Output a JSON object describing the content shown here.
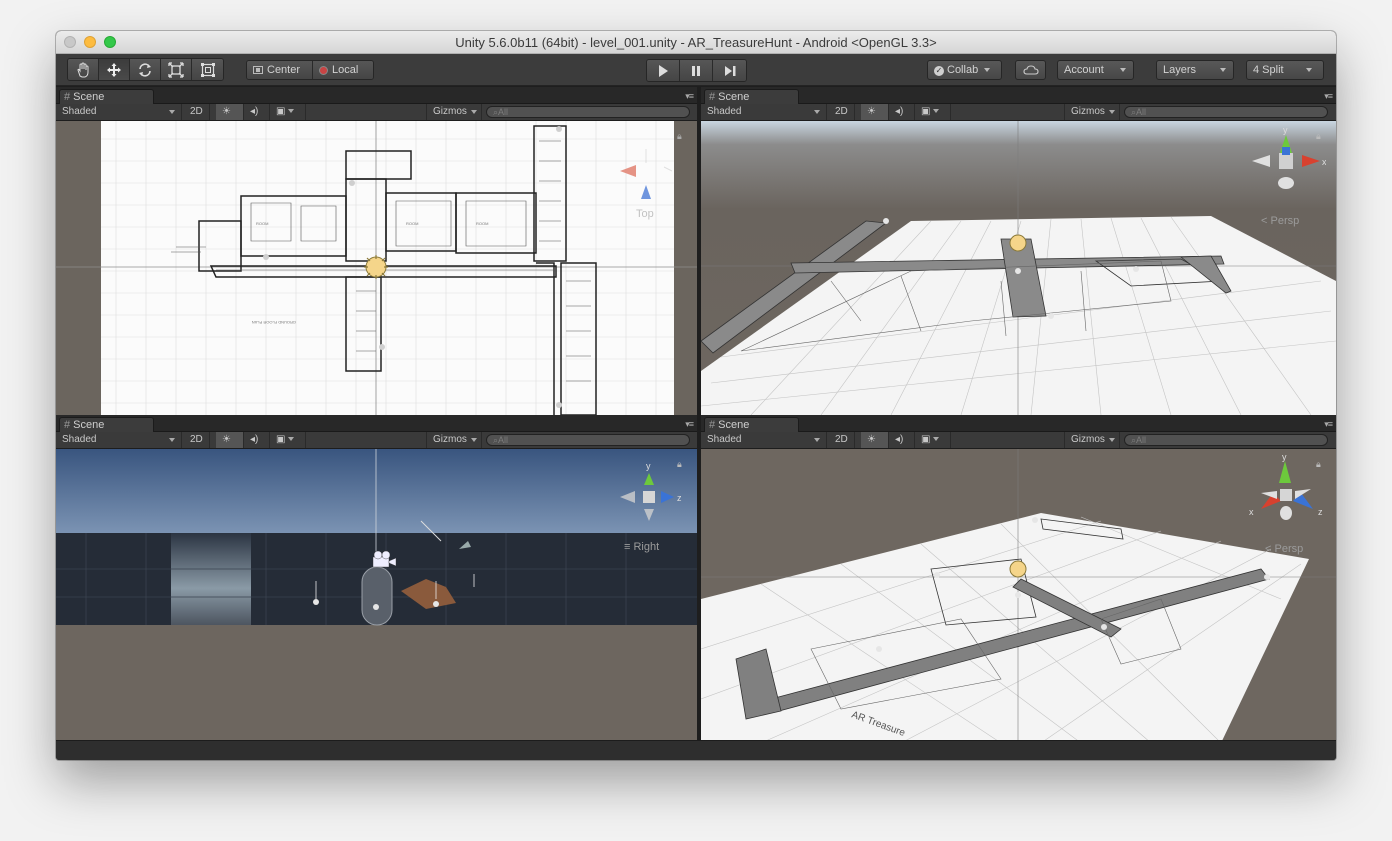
{
  "window": {
    "title": "Unity 5.6.0b11 (64bit) - level_001.unity - AR_TreasureHunt - Android <OpenGL 3.3>"
  },
  "toolbar": {
    "tools": [
      {
        "name": "hand-tool"
      },
      {
        "name": "move-tool"
      },
      {
        "name": "rotate-tool"
      },
      {
        "name": "scale-tool"
      },
      {
        "name": "rect-tool"
      }
    ],
    "pivot_label": "Center",
    "space_label": "Local",
    "collab_label": "Collab",
    "account_label": "Account",
    "layers_label": "Layers",
    "layout_label": "4 Split"
  },
  "panels": [
    {
      "tab": "Scene",
      "shading": "Shaded",
      "mode_2d": "2D",
      "gizmos": "Gizmos",
      "search_placeholder": "All",
      "gizmo_label": "Top"
    },
    {
      "tab": "Scene",
      "shading": "Shaded",
      "mode_2d": "2D",
      "gizmos": "Gizmos",
      "search_placeholder": "All",
      "gizmo_label": "Persp"
    },
    {
      "tab": "Scene",
      "shading": "Shaded",
      "mode_2d": "2D",
      "gizmos": "Gizmos",
      "search_placeholder": "All",
      "gizmo_label": "Right"
    },
    {
      "tab": "Scene",
      "shading": "Shaded",
      "mode_2d": "2D",
      "gizmos": "Gizmos",
      "search_placeholder": "All",
      "gizmo_label": "Persp"
    }
  ],
  "gizmo_axes": {
    "x": "x",
    "y": "y",
    "z": "z"
  },
  "colors": {
    "x_axis": "#d8412f",
    "y_axis": "#6dc93c",
    "z_axis": "#3a73d6",
    "editor_bg": "#3c3c3c",
    "ground": "#6e6760"
  }
}
